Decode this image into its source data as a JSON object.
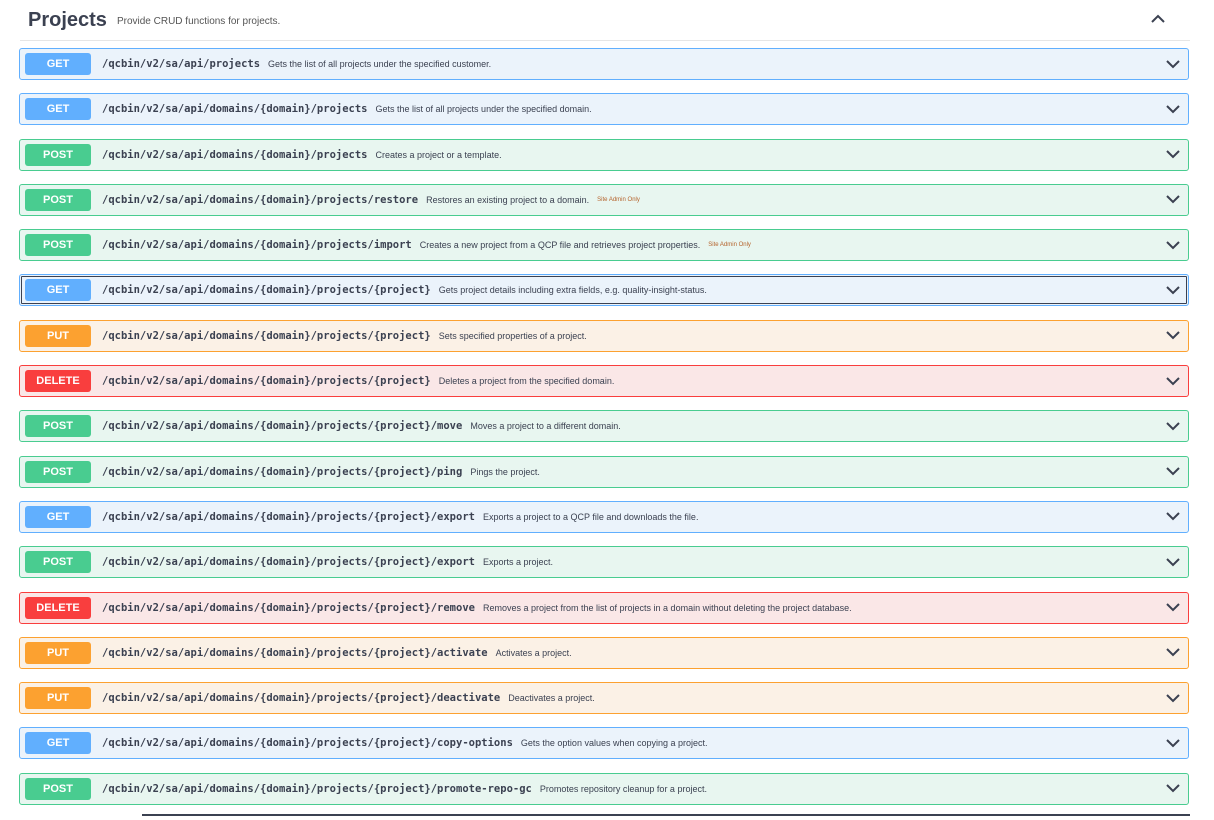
{
  "section": {
    "title": "Projects",
    "description": "Provide CRUD functions for projects."
  },
  "operations": [
    {
      "method": "GET",
      "path": "/qcbin/v2/sa/api/projects",
      "summary": "Gets the list of all projects under the specified customer.",
      "badge": ""
    },
    {
      "method": "GET",
      "path": "/qcbin/v2/sa/api/domains/{domain}/projects",
      "summary": "Gets the list of all projects under the specified domain.",
      "badge": ""
    },
    {
      "method": "POST",
      "path": "/qcbin/v2/sa/api/domains/{domain}/projects",
      "summary": "Creates a project or a template.",
      "badge": ""
    },
    {
      "method": "POST",
      "path": "/qcbin/v2/sa/api/domains/{domain}/projects/restore",
      "summary": "Restores an existing project to a domain.",
      "badge": "Site Admin Only"
    },
    {
      "method": "POST",
      "path": "/qcbin/v2/sa/api/domains/{domain}/projects/import",
      "summary": "Creates a new project from a QCP file and retrieves project properties.",
      "badge": "Site Admin Only"
    },
    {
      "method": "GET",
      "path": "/qcbin/v2/sa/api/domains/{domain}/projects/{project}",
      "summary": "Gets project details including extra fields, e.g. quality-insight-status.",
      "badge": "",
      "focused": true
    },
    {
      "method": "PUT",
      "path": "/qcbin/v2/sa/api/domains/{domain}/projects/{project}",
      "summary": "Sets specified properties of a project.",
      "badge": ""
    },
    {
      "method": "DELETE",
      "path": "/qcbin/v2/sa/api/domains/{domain}/projects/{project}",
      "summary": "Deletes a project from the specified domain.",
      "badge": ""
    },
    {
      "method": "POST",
      "path": "/qcbin/v2/sa/api/domains/{domain}/projects/{project}/move",
      "summary": "Moves a project to a different domain.",
      "badge": ""
    },
    {
      "method": "POST",
      "path": "/qcbin/v2/sa/api/domains/{domain}/projects/{project}/ping",
      "summary": "Pings the project.",
      "badge": ""
    },
    {
      "method": "GET",
      "path": "/qcbin/v2/sa/api/domains/{domain}/projects/{project}/export",
      "summary": "Exports a project to a QCP file and downloads the file.",
      "badge": ""
    },
    {
      "method": "POST",
      "path": "/qcbin/v2/sa/api/domains/{domain}/projects/{project}/export",
      "summary": "Exports a project.",
      "badge": ""
    },
    {
      "method": "DELETE",
      "path": "/qcbin/v2/sa/api/domains/{domain}/projects/{project}/remove",
      "summary": "Removes a project from the list of projects in a domain without deleting the project database.",
      "badge": ""
    },
    {
      "method": "PUT",
      "path": "/qcbin/v2/sa/api/domains/{domain}/projects/{project}/activate",
      "summary": "Activates a project.",
      "badge": ""
    },
    {
      "method": "PUT",
      "path": "/qcbin/v2/sa/api/domains/{domain}/projects/{project}/deactivate",
      "summary": "Deactivates a project.",
      "badge": ""
    },
    {
      "method": "GET",
      "path": "/qcbin/v2/sa/api/domains/{domain}/projects/{project}/copy-options",
      "summary": "Gets the option values when copying a project.",
      "badge": ""
    },
    {
      "method": "POST",
      "path": "/qcbin/v2/sa/api/domains/{domain}/projects/{project}/promote-repo-gc",
      "summary": "Promotes repository cleanup for a project.",
      "badge": ""
    }
  ],
  "icons": {
    "collapse": "chevron-up-icon",
    "expand": "chevron-down-icon"
  },
  "colors": {
    "get": "#61affe",
    "post": "#49cc90",
    "put": "#fca130",
    "delete": "#f93e3e"
  }
}
